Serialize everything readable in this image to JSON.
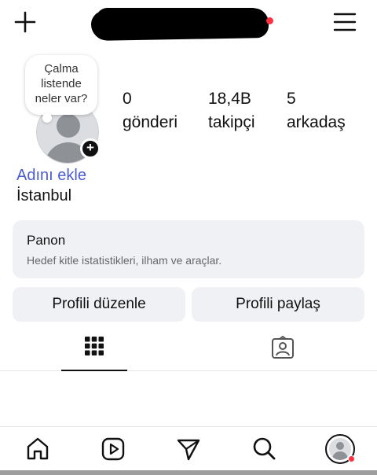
{
  "header": {
    "username": ""
  },
  "note": {
    "text": "Çalma listende neler var?"
  },
  "stats": {
    "posts": {
      "value": "0",
      "label": "gönderi"
    },
    "followers": {
      "value": "18,4B",
      "label": "takipçi"
    },
    "friends": {
      "value": "5",
      "label": "arkadaş"
    }
  },
  "profile": {
    "add_name_link": "Adını ekle",
    "location": "İstanbul"
  },
  "dashboard": {
    "title": "Panon",
    "description": "Hedef kitle istatistikleri, ilham ve araçlar."
  },
  "buttons": {
    "edit_profile": "Profili düzenle",
    "share_profile": "Profili paylaş"
  },
  "tabs": [
    {
      "icon": "grid-icon",
      "active": true
    },
    {
      "icon": "tagged-icon",
      "active": false
    }
  ],
  "bottom_nav": [
    "home-icon",
    "reels-icon",
    "send-icon",
    "search-icon",
    "profile-avatar"
  ],
  "colors": {
    "link": "#4a5bd0",
    "notification": "#ff3040",
    "card": "#eff1f4"
  }
}
